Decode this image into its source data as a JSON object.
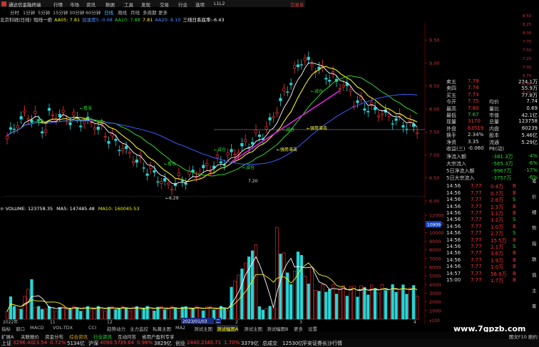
{
  "titlebar": {
    "app_title": "通达信金融终端",
    "menus": [
      "行情",
      "市场",
      "资讯",
      "数据",
      "工具",
      "发现",
      "交易",
      "行业",
      "选项",
      "L1L2"
    ],
    "trade_label": "交易系"
  },
  "periods": {
    "items": [
      "分时",
      "1分钟",
      "5分钟",
      "15分钟",
      "30分钟",
      "60分钟",
      "日线",
      "周线",
      "月线",
      "多周期",
      "更多"
    ],
    "active": "日线"
  },
  "formula_bar": {
    "stock": "北京科锐(日线)",
    "indicator": "短线一绝",
    "items": [
      {
        "text": "AA05: 7.81",
        "color": "#f4f40c"
      },
      {
        "text": "加速度5:-0.08",
        "color": "#4f8cff"
      },
      {
        "text": "AA10: 7.88",
        "color": "#2fd52f"
      },
      {
        "text": "7.81",
        "color": "#f4f40c"
      },
      {
        "text": "AA20: 8.10",
        "color": "#4f8cff"
      },
      {
        "text": "三线日系底率:-6.43",
        "color": "#ffffff"
      }
    ]
  },
  "price_axis": [
    "9.50",
    "9.00",
    "8.50",
    "8.00",
    "7.50",
    "7.00",
    "6.50",
    "6.00"
  ],
  "chart_annotations": {
    "buy_labels": [
      "←减仓",
      "←看涨",
      "←看仓",
      "←减仓",
      "←减仓",
      "←减仓",
      "←减仓"
    ],
    "stop_labels": [
      "←强势滞击",
      "←强势滞击"
    ],
    "low_price_label": "←6.29",
    "mid_price_label": "7.20"
  },
  "volume": {
    "header": [
      {
        "text": "VOLUME: 123758.35",
        "color": "#ffffff"
      },
      {
        "text": "MA5: 147485.48",
        "color": "#ffffff"
      },
      {
        "text": "MA10: 160045.53",
        "color": "#f4f40c"
      }
    ],
    "axis": [
      "12000",
      "11000",
      "10000",
      "9000",
      "8000",
      "7000",
      "6000",
      "5000",
      "4000",
      "3000",
      "2000",
      "1000"
    ],
    "axis_unit": "x100",
    "current_tag": "10909"
  },
  "date_labels": {
    "year": "2022年",
    "months": [
      "11",
      "12",
      "2",
      "3"
    ],
    "cursor_date": "2023/01/03",
    "cursor_day": "二",
    "right_mark": "4"
  },
  "quote": {
    "rows": [
      {
        "label": "卖五",
        "value": "7.79",
        "value_color": "#ff3333",
        "label2": "",
        "value2": "274.1万"
      },
      {
        "label": "卖四",
        "value": "7.74",
        "value_color": "#ff3333",
        "label2": "",
        "value2": "55.9万"
      },
      {
        "label": "买五",
        "value": "7.73",
        "value_color": "#ff3333",
        "label2": "",
        "value2": "77.8万"
      },
      {
        "label": "今开",
        "value": "7.75",
        "value_color": "#ff3333",
        "label2": "均价",
        "value2": "7.74"
      },
      {
        "label": "最高",
        "value": "7.80",
        "value_color": "#ff3333",
        "label2": "量比",
        "value2": "0.69"
      },
      {
        "label": "最低",
        "value": "7.67",
        "value_color": "#2fd52f",
        "label2": "市值",
        "value2": "42.1亿"
      },
      {
        "label": "现量",
        "value": "3170",
        "value_color": "#ff3333",
        "label2": "总量",
        "value2": "123758"
      },
      {
        "label": "外盘",
        "value": "63519",
        "value_color": "#ff3333",
        "label2": "内盘",
        "value2": "60239"
      },
      {
        "label": "换手",
        "value": "2.34%",
        "value_color": "#dddddd",
        "label2": "股本",
        "value2": "5.46亿"
      },
      {
        "label": "净资",
        "value": "3.35",
        "value_color": "#dddddd",
        "label2": "流通",
        "value2": "5.29亿"
      },
      {
        "label": "收益(三)",
        "value": "-0.060",
        "value_color": "#dddddd",
        "label2": "PE(动)",
        "value2": ""
      }
    ],
    "flow": [
      {
        "label": "净流入额",
        "value": "-381.3万",
        "pct": "-4%"
      },
      {
        "label": "大宗流入",
        "value": "-565.3万",
        "pct": "-6%"
      },
      {
        "label": "5日净流入额",
        "value": "-9967万",
        "pct": "-17%"
      },
      {
        "label": "5日大宗流入",
        "value": "-3757万",
        "pct": "-6%"
      }
    ],
    "right_axis": [
      "8.50",
      "8.25",
      "8.00",
      "7.75",
      "7.50",
      "7.25",
      "7.00",
      "6.75",
      "6.50",
      "6.25"
    ],
    "trades": [
      {
        "time": "14:56",
        "price": "7.77",
        "vol": "0.4万",
        "side": "B"
      },
      {
        "time": "14:56",
        "price": "7.77",
        "vol": "0.7万",
        "side": "B"
      },
      {
        "time": "14:56",
        "price": "7.77",
        "vol": "2.8万",
        "side": "S"
      },
      {
        "time": "14:56",
        "price": "7.77",
        "vol": "2.3万",
        "side": "B"
      },
      {
        "time": "14:56",
        "price": "7.77",
        "vol": "1.1万",
        "side": "B"
      },
      {
        "time": "14:56",
        "price": "7.77",
        "vol": "1.2万",
        "side": "S"
      },
      {
        "time": "14:56",
        "price": "7.77",
        "vol": "1.0万",
        "side": "B"
      },
      {
        "time": "14:56",
        "price": "7.77",
        "vol": "2.7万",
        "side": "S"
      },
      {
        "time": "14:56",
        "price": "7.77",
        "vol": "15.5万",
        "side": "B"
      },
      {
        "time": "14:56",
        "price": "7.77",
        "vol": "2.1万",
        "side": "S"
      },
      {
        "time": "14:56",
        "price": "7.77",
        "vol": "3.6万",
        "side": "B"
      },
      {
        "time": "14:56",
        "price": "7.77",
        "vol": "1.9万",
        "side": "B"
      },
      {
        "time": "14:56",
        "price": "7.77",
        "vol": "1.0万",
        "side": "B"
      },
      {
        "time": "14:57",
        "price": "7.77",
        "vol": "56.9万",
        "side": "B"
      },
      {
        "time": "15:00",
        "price": "7.77",
        "vol": "1.7万",
        "side": "B"
      }
    ],
    "side_tags": [
      "笔",
      "价",
      "细",
      "势",
      "指",
      "联",
      "值",
      "主",
      "筹"
    ]
  },
  "bottom_tabs": {
    "items": [
      "指标",
      "窗口",
      "MACD",
      "VOL-TDX",
      "CCI",
      "趋势动力",
      "主力监控",
      "私募主图",
      "MA2",
      "测试主图",
      "测试幅图A",
      "测试主图",
      "测试幅图B",
      "更多",
      "设置"
    ],
    "active": "测试幅图A"
  },
  "toolbar2": {
    "items": [
      {
        "text": "扩展A",
        "color": "#cccccc"
      },
      {
        "text": "关联报价",
        "color": "#cccccc"
      },
      {
        "text": "资金分布",
        "color": "#cccccc"
      },
      {
        "text": "综合资讯",
        "color": "#e0a020"
      },
      {
        "text": "行业资讯",
        "color": "#2fd52f"
      },
      {
        "text": "互动问答",
        "color": "#cccccc"
      },
      {
        "text": "省用户盈利专享",
        "color": "#cccccc"
      }
    ],
    "right": "图文F10 剧约"
  },
  "statusbar": {
    "indices": [
      {
        "name": "上证",
        "value": "3296.40",
        "change": "23.54",
        "pct": "0.72%",
        "amount": "5134亿"
      },
      {
        "name": "沪深",
        "value": "4090.57",
        "change": "39.64",
        "pct": "0.98%",
        "amount": "3829亿"
      },
      {
        "name": "创业",
        "value": "2440.21",
        "change": "40.71",
        "pct": "1.70%",
        "amount": "3379亿"
      }
    ],
    "extra_label": "总成交",
    "extra_value": "12530亿",
    "ticker": "平安证券长沙行情"
  },
  "watermark": "www.7gpzb.com",
  "colors": {
    "up": "#ff3333",
    "down": "#28d6d6",
    "ma_white": "#ffffff",
    "ma_yellow": "#f4f40c",
    "ma_green": "#2fd52f",
    "ma_blue": "#3b5bff",
    "ma_magenta": "#e020e0"
  }
}
